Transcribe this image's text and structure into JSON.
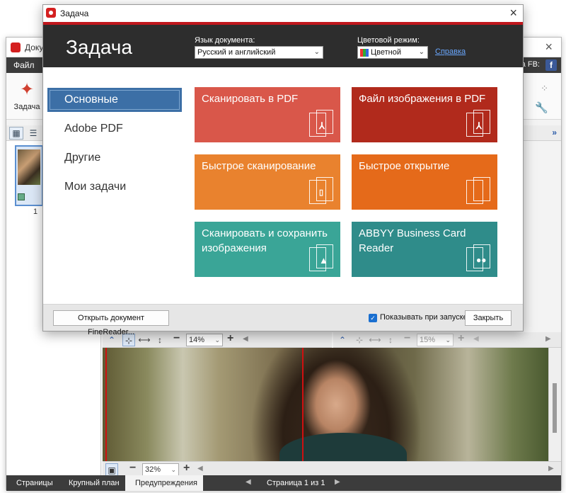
{
  "main_window": {
    "title": "Доку",
    "menu_file": "Файл",
    "menu_right": "а FB:",
    "fb_icon": "f",
    "ribbon": {
      "task_label": "Задача"
    },
    "pages_panel": {
      "page_number": "1"
    },
    "left_toolbar": {
      "zoom": "14%"
    },
    "right_toolbar": {
      "zoom": "15%"
    },
    "bottom_toolbar": {
      "zoom": "32%"
    },
    "statusbar": {
      "tabs": [
        "Страницы",
        "Крупный план",
        "Предупреждения"
      ],
      "page_info": "Страница 1 из 1"
    }
  },
  "dialog": {
    "title": "Задача",
    "header": {
      "heading": "Задача",
      "language_label": "Язык документа:",
      "language_value": "Русский и английский",
      "color_label": "Цветовой режим:",
      "color_value": "Цветной",
      "help_link": "Справка"
    },
    "nav": [
      {
        "label": "Основные",
        "active": true
      },
      {
        "label": "Adobe PDF",
        "active": false
      },
      {
        "label": "Другие",
        "active": false
      },
      {
        "label": "Мои задачи",
        "active": false
      }
    ],
    "tiles": [
      {
        "label": "Сканировать в PDF",
        "color": "#d9574a",
        "icon": "pdf-icon"
      },
      {
        "label": "Файл изображения в PDF",
        "color": "#b12a1c",
        "icon": "pdf-icon"
      },
      {
        "label": "Быстрое сканирование",
        "color": "#e9822e",
        "icon": "document-icon"
      },
      {
        "label": "Быстрое открытие",
        "color": "#e56a1a",
        "icon": "folder-open-icon"
      },
      {
        "label": "Сканировать и сохранить изображения",
        "color": "#3aa597",
        "icon": "image-icon"
      },
      {
        "label": "ABBYY Business Card Reader",
        "color": "#2f8c8a",
        "icon": "contacts-icon"
      }
    ],
    "footer": {
      "open_button": "Открыть документ FineReader...",
      "show_on_start_label": "Показывать при запуске",
      "show_on_start_checked": true,
      "close_button": "Закрыть"
    }
  },
  "colors": {
    "accent_red": "#c0161c",
    "header_dark": "#2d2d2d",
    "nav_active": "#3c6fa6",
    "link": "#6aa8ff"
  }
}
